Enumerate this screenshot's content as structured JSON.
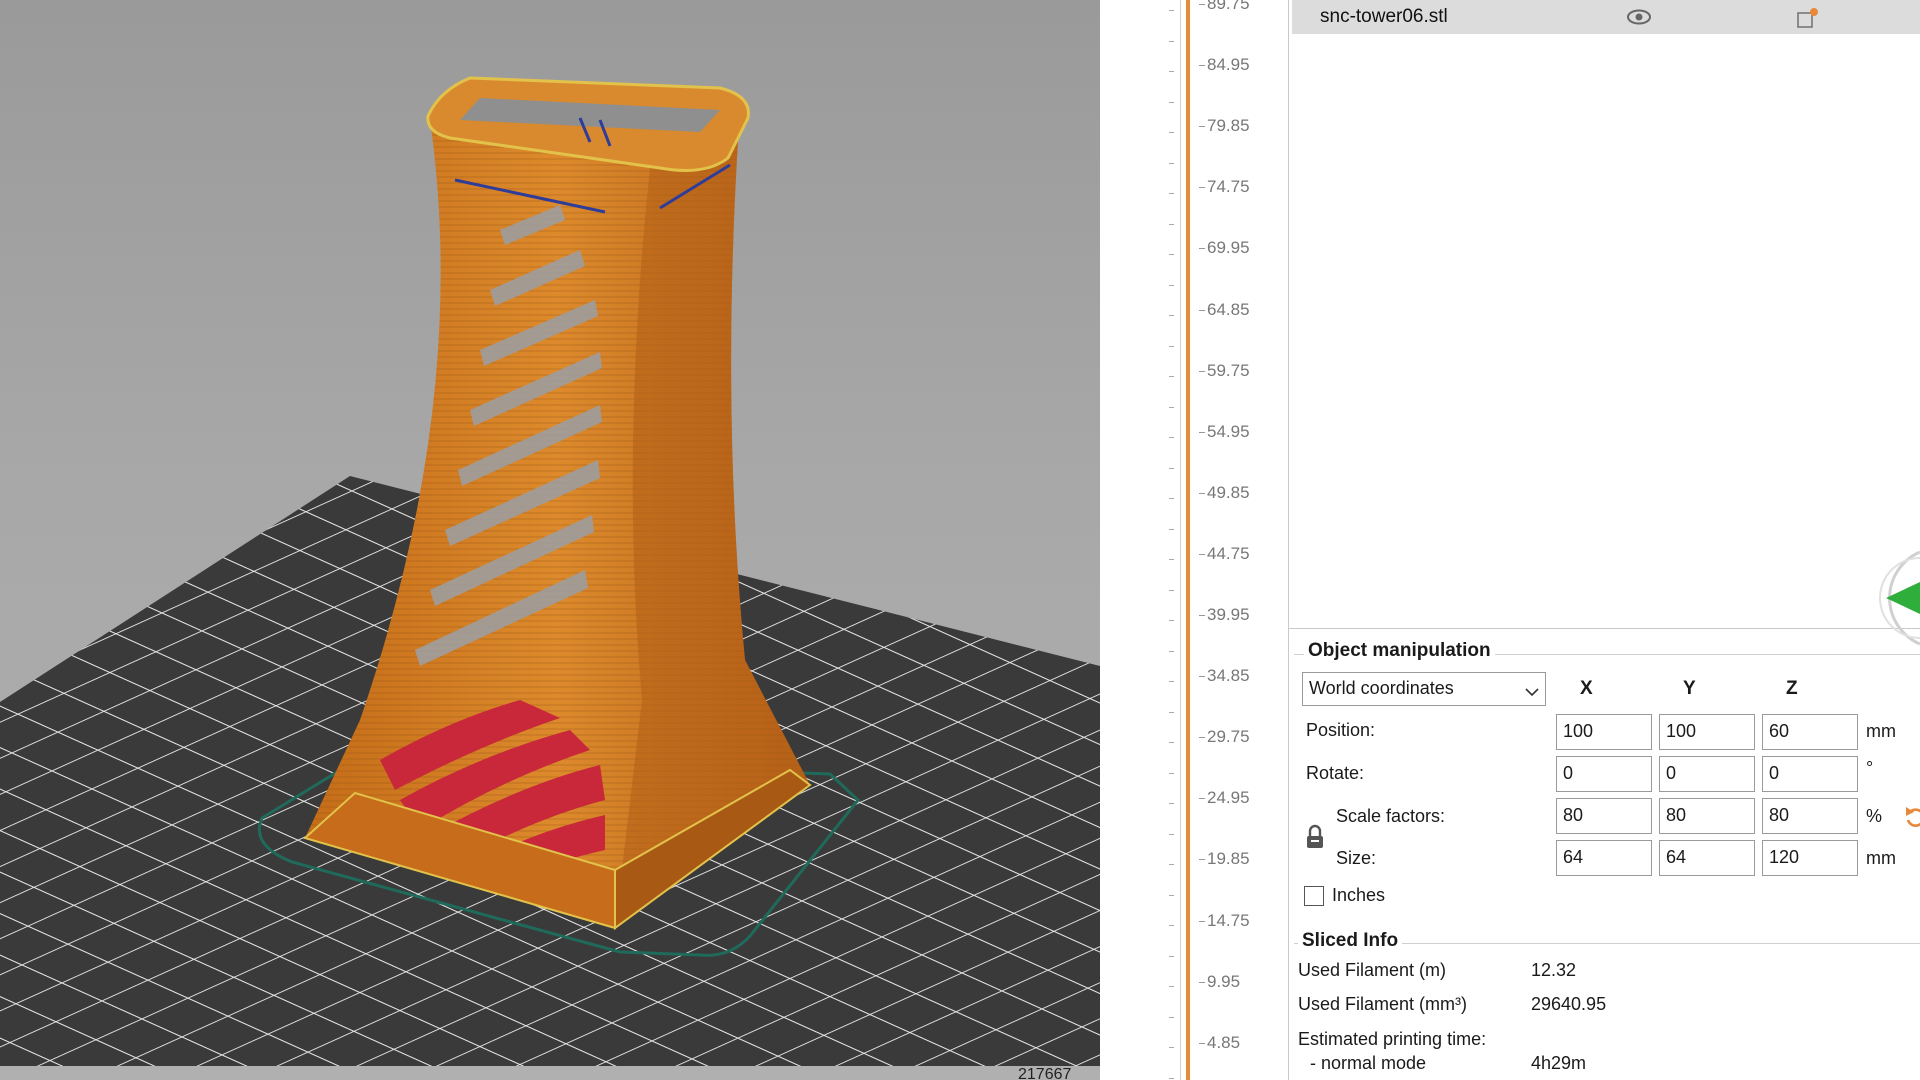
{
  "viewport": {
    "corner_count": "217667"
  },
  "layer_slider": {
    "ticks": [
      "89.75",
      "84.95",
      "79.85",
      "74.75",
      "69.95",
      "64.85",
      "59.75",
      "54.95",
      "49.85",
      "44.75",
      "39.95",
      "34.85",
      "29.75",
      "24.95",
      "19.85",
      "14.75",
      "9.95",
      "4.85"
    ]
  },
  "object_list": {
    "object_name": "snc-tower06.stl"
  },
  "object_manipulation": {
    "title": "Object manipulation",
    "coordinate_system": "World coordinates",
    "axes": [
      "X",
      "Y",
      "Z"
    ],
    "position": {
      "label": "Position:",
      "x": "100",
      "y": "100",
      "z": "60",
      "unit": "mm"
    },
    "rotate": {
      "label": "Rotate:",
      "x": "0",
      "y": "0",
      "z": "0",
      "unit": "°"
    },
    "scale": {
      "label": "Scale factors:",
      "x": "80",
      "y": "80",
      "z": "80",
      "unit": "%"
    },
    "size": {
      "label": "Size:",
      "x": "64",
      "y": "64",
      "z": "120",
      "unit": "mm"
    },
    "inches_label": "Inches"
  },
  "sliced_info": {
    "title": "Sliced Info",
    "used_filament_m_label": "Used Filament (m)",
    "used_filament_m": "12.32",
    "used_filament_mm3_label": "Used Filament (mm³)",
    "used_filament_mm3": "29640.95",
    "estimated_time_label": "Estimated printing time:",
    "normal_mode_label": "- normal mode",
    "normal_mode_time": "4h29m"
  },
  "colors": {
    "accent_orange": "#e8883a",
    "model_orange": "#d27a1f",
    "bed_dark": "#3c3c3c",
    "infill_red": "#c8283a"
  },
  "icons": [
    "eye-icon",
    "settings-icon",
    "chevron-down-icon",
    "lock-icon",
    "reset-icon",
    "arrow-right-icon"
  ]
}
